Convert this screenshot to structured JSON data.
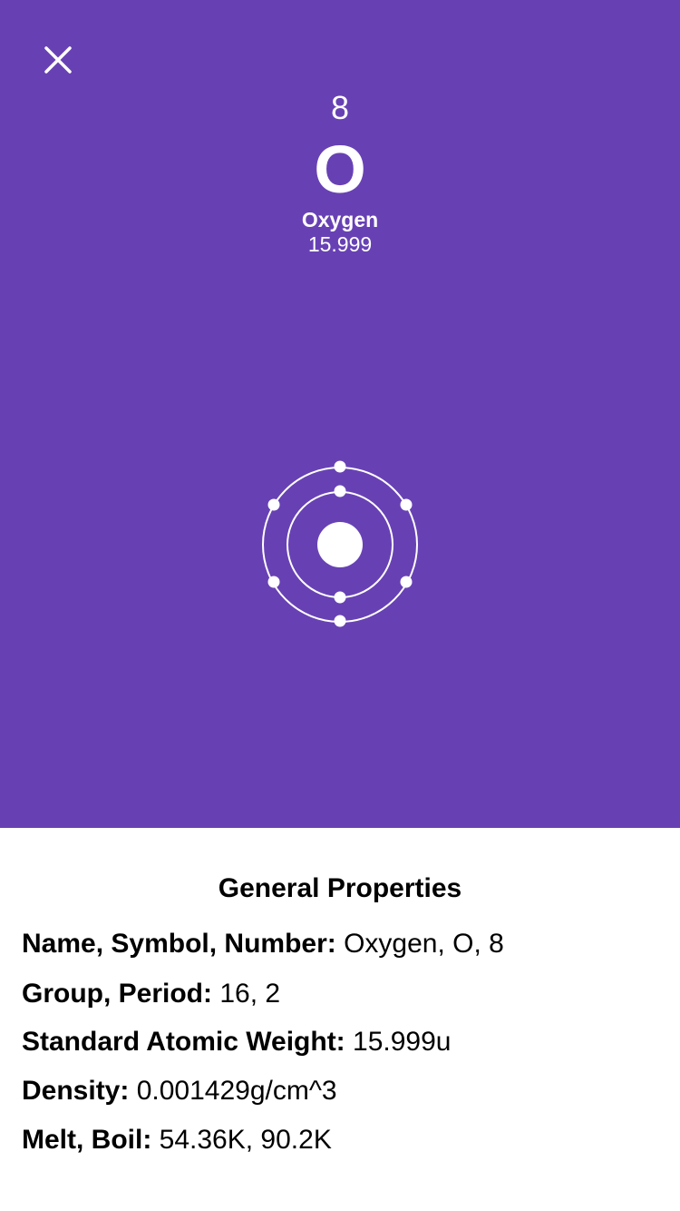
{
  "header": {
    "close_icon": "close-icon",
    "atomic_number": "8",
    "symbol": "O",
    "name": "Oxygen",
    "atomic_weight": "15.999"
  },
  "atom_model": {
    "icon": "bohr-model-icon",
    "shells": [
      2,
      6
    ],
    "color": "#ffffff"
  },
  "colors": {
    "hero_background": "#6741b4",
    "panel_background": "#ffffff"
  },
  "properties": {
    "title": "General Properties",
    "rows": [
      {
        "label": "Name, Symbol, Number:",
        "value": "Oxygen, O, 8"
      },
      {
        "label": "Group, Period:",
        "value": "16, 2"
      },
      {
        "label": "Standard Atomic Weight:",
        "value": "15.999u"
      },
      {
        "label": "Density:",
        "value": "0.001429g/cm^3"
      },
      {
        "label": "Melt, Boil:",
        "value": "54.36K, 90.2K"
      }
    ]
  }
}
